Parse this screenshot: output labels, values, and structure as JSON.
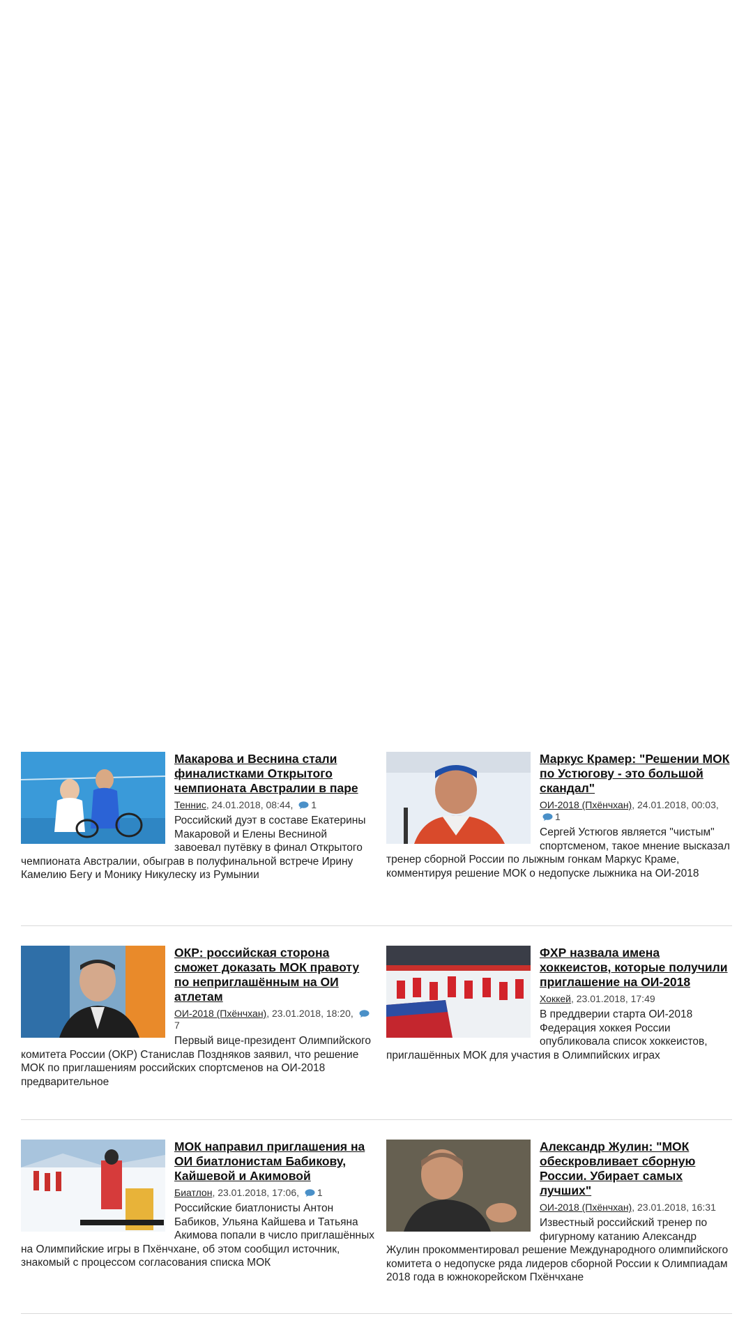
{
  "news": [
    {
      "title": "Макарова и Веснина стали финалистками Открытого чемпионата Австралии в паре",
      "category": "Теннис",
      "datetime": ", 24.01.2018, 08:44, ",
      "comments": "1",
      "summary": "Российский дуэт в составе Екатерины Макаровой и Елены Весниной завоевал путёвку в финал Открытого чемпионата Австралии, обыграв в полуфинальной встрече Ирину Камелию Бегу и Монику Никулеску из Румынии",
      "image": "tennis-photo"
    },
    {
      "title": "Маркус Крамер: \"Решении МОК по Устюгову - это большой скандал\"",
      "category": "ОИ-2018 (Пхёнчхан)",
      "datetime": ", 24.01.2018, 00:03, ",
      "comments": "1",
      "summary": "Сергей Устюгов является \"чистым\" спортсменом, такое мнение высказал тренер сборной России по лыжным гонкам Маркус Краме, комментируя решение МОК о недопуске лыжника на ОИ-2018",
      "image": "skier-photo"
    },
    {
      "title": "ОКР: российская сторона сможет доказать МОК правоту по неприглашённым на ОИ атлетам",
      "category": "ОИ-2018 (Пхёнчхан)",
      "datetime": ", 23.01.2018, 18:20, ",
      "comments": "7",
      "summary": "Первый вице-президент Олимпийского комитета России (ОКР) Станислав Поздняков заявил, что решение МОК по приглашениям российских спортсменов на ОИ-2018 предварительное",
      "image": "official-photo"
    },
    {
      "title": "ФХР назвала имена хоккеистов, которые получили приглашение на ОИ-2018",
      "category": "Хоккей",
      "datetime": ", 23.01.2018, 17:49",
      "comments": "",
      "summary": "В преддверии старта ОИ-2018 Федерация хоккея России опубликовала список хоккеистов, приглашённых МОК для участия в Олимпийских играх",
      "image": "hockey-photo"
    },
    {
      "title": "МОК направил приглашения на ОИ биатлонистам Бабикову, Кайшевой и Акимовой",
      "category": "Биатлон",
      "datetime": ", 23.01.2018, 17:06, ",
      "comments": "1",
      "summary": "Российские биатлонисты Антон Бабиков, Ульяна Кайшева и Татьяна Акимова попали в число приглашённых на Олимпийские игры в Пхёнчхане, об этом сообщил источник, знакомый с процессом согласования списка МОК",
      "image": "biathlon-photo"
    },
    {
      "title": "Александр Жулин: \"МОК обескровливает сборную России. Убирает самых лучших\"",
      "category": "ОИ-2018 (Пхёнчхан)",
      "datetime": ", 23.01.2018, 16:31",
      "comments": "",
      "summary": "Известный российский тренер по фигурному катанию Александр Жулин прокомментировал решение Международного олимпийского комитета о недопуске ряда лидеров сборной России к Олимпиадам 2018 года в южнокорейском Пхёнчхане",
      "image": "coach-photo"
    }
  ],
  "colors": {
    "comment_icon": "#4a90c8",
    "divider": "#d9d9d9"
  }
}
